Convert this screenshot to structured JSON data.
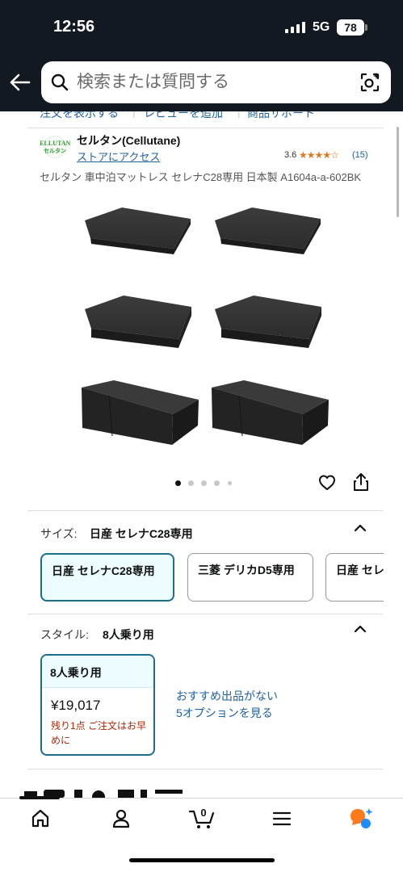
{
  "status_bar": {
    "time": "12:56",
    "network": "5G",
    "battery": "78"
  },
  "search": {
    "placeholder": "検索または質問する"
  },
  "top_links": [
    "注文を表示する",
    "レビューを追加",
    "商品サポート"
  ],
  "seller": {
    "logo_text": "CELLUTANE セルタン",
    "name": "セルタン(Cellutane)",
    "store_link": "ストアにアクセス",
    "rating": "3.6",
    "stars": "★★★★☆",
    "rating_count": "(15)"
  },
  "product": {
    "title": "セルタン 車中泊マットレス セレナC28専用 日本製 A1604a-a-602BK",
    "image_icon": "product-cushions-image",
    "image_dots": {
      "count": 5,
      "active_index": 0
    }
  },
  "size": {
    "label": "サイズ:",
    "value": "日産 セレナC28専用",
    "options": [
      "日産 セレナC28専用",
      "三菱 デリカD5専用",
      "日産 セレナ"
    ],
    "selected_index": 0
  },
  "style": {
    "label": "スタイル:",
    "value": "8人乗り用",
    "card": {
      "name": "8人乗り用",
      "price": "¥19,017",
      "stock": "残り1点 ご注文はお早めに"
    },
    "recommend_line1": "おすすめ出品がない",
    "recommend_line2": "5オプションを見る"
  },
  "bottom_nav": {
    "icons": [
      "home-icon",
      "account-icon",
      "cart-icon",
      "menu-icon",
      "rufus-icon"
    ],
    "cart_count": "0"
  },
  "colors": {
    "header_bg": "#131921",
    "link": "#2162a1",
    "selected_border": "#1d6e8e",
    "selected_bg": "#edfdff",
    "star": "#de7921",
    "stock_red": "#b12704",
    "rufus_orange": "#ff7a1a",
    "rufus_blue": "#1a8cff"
  }
}
